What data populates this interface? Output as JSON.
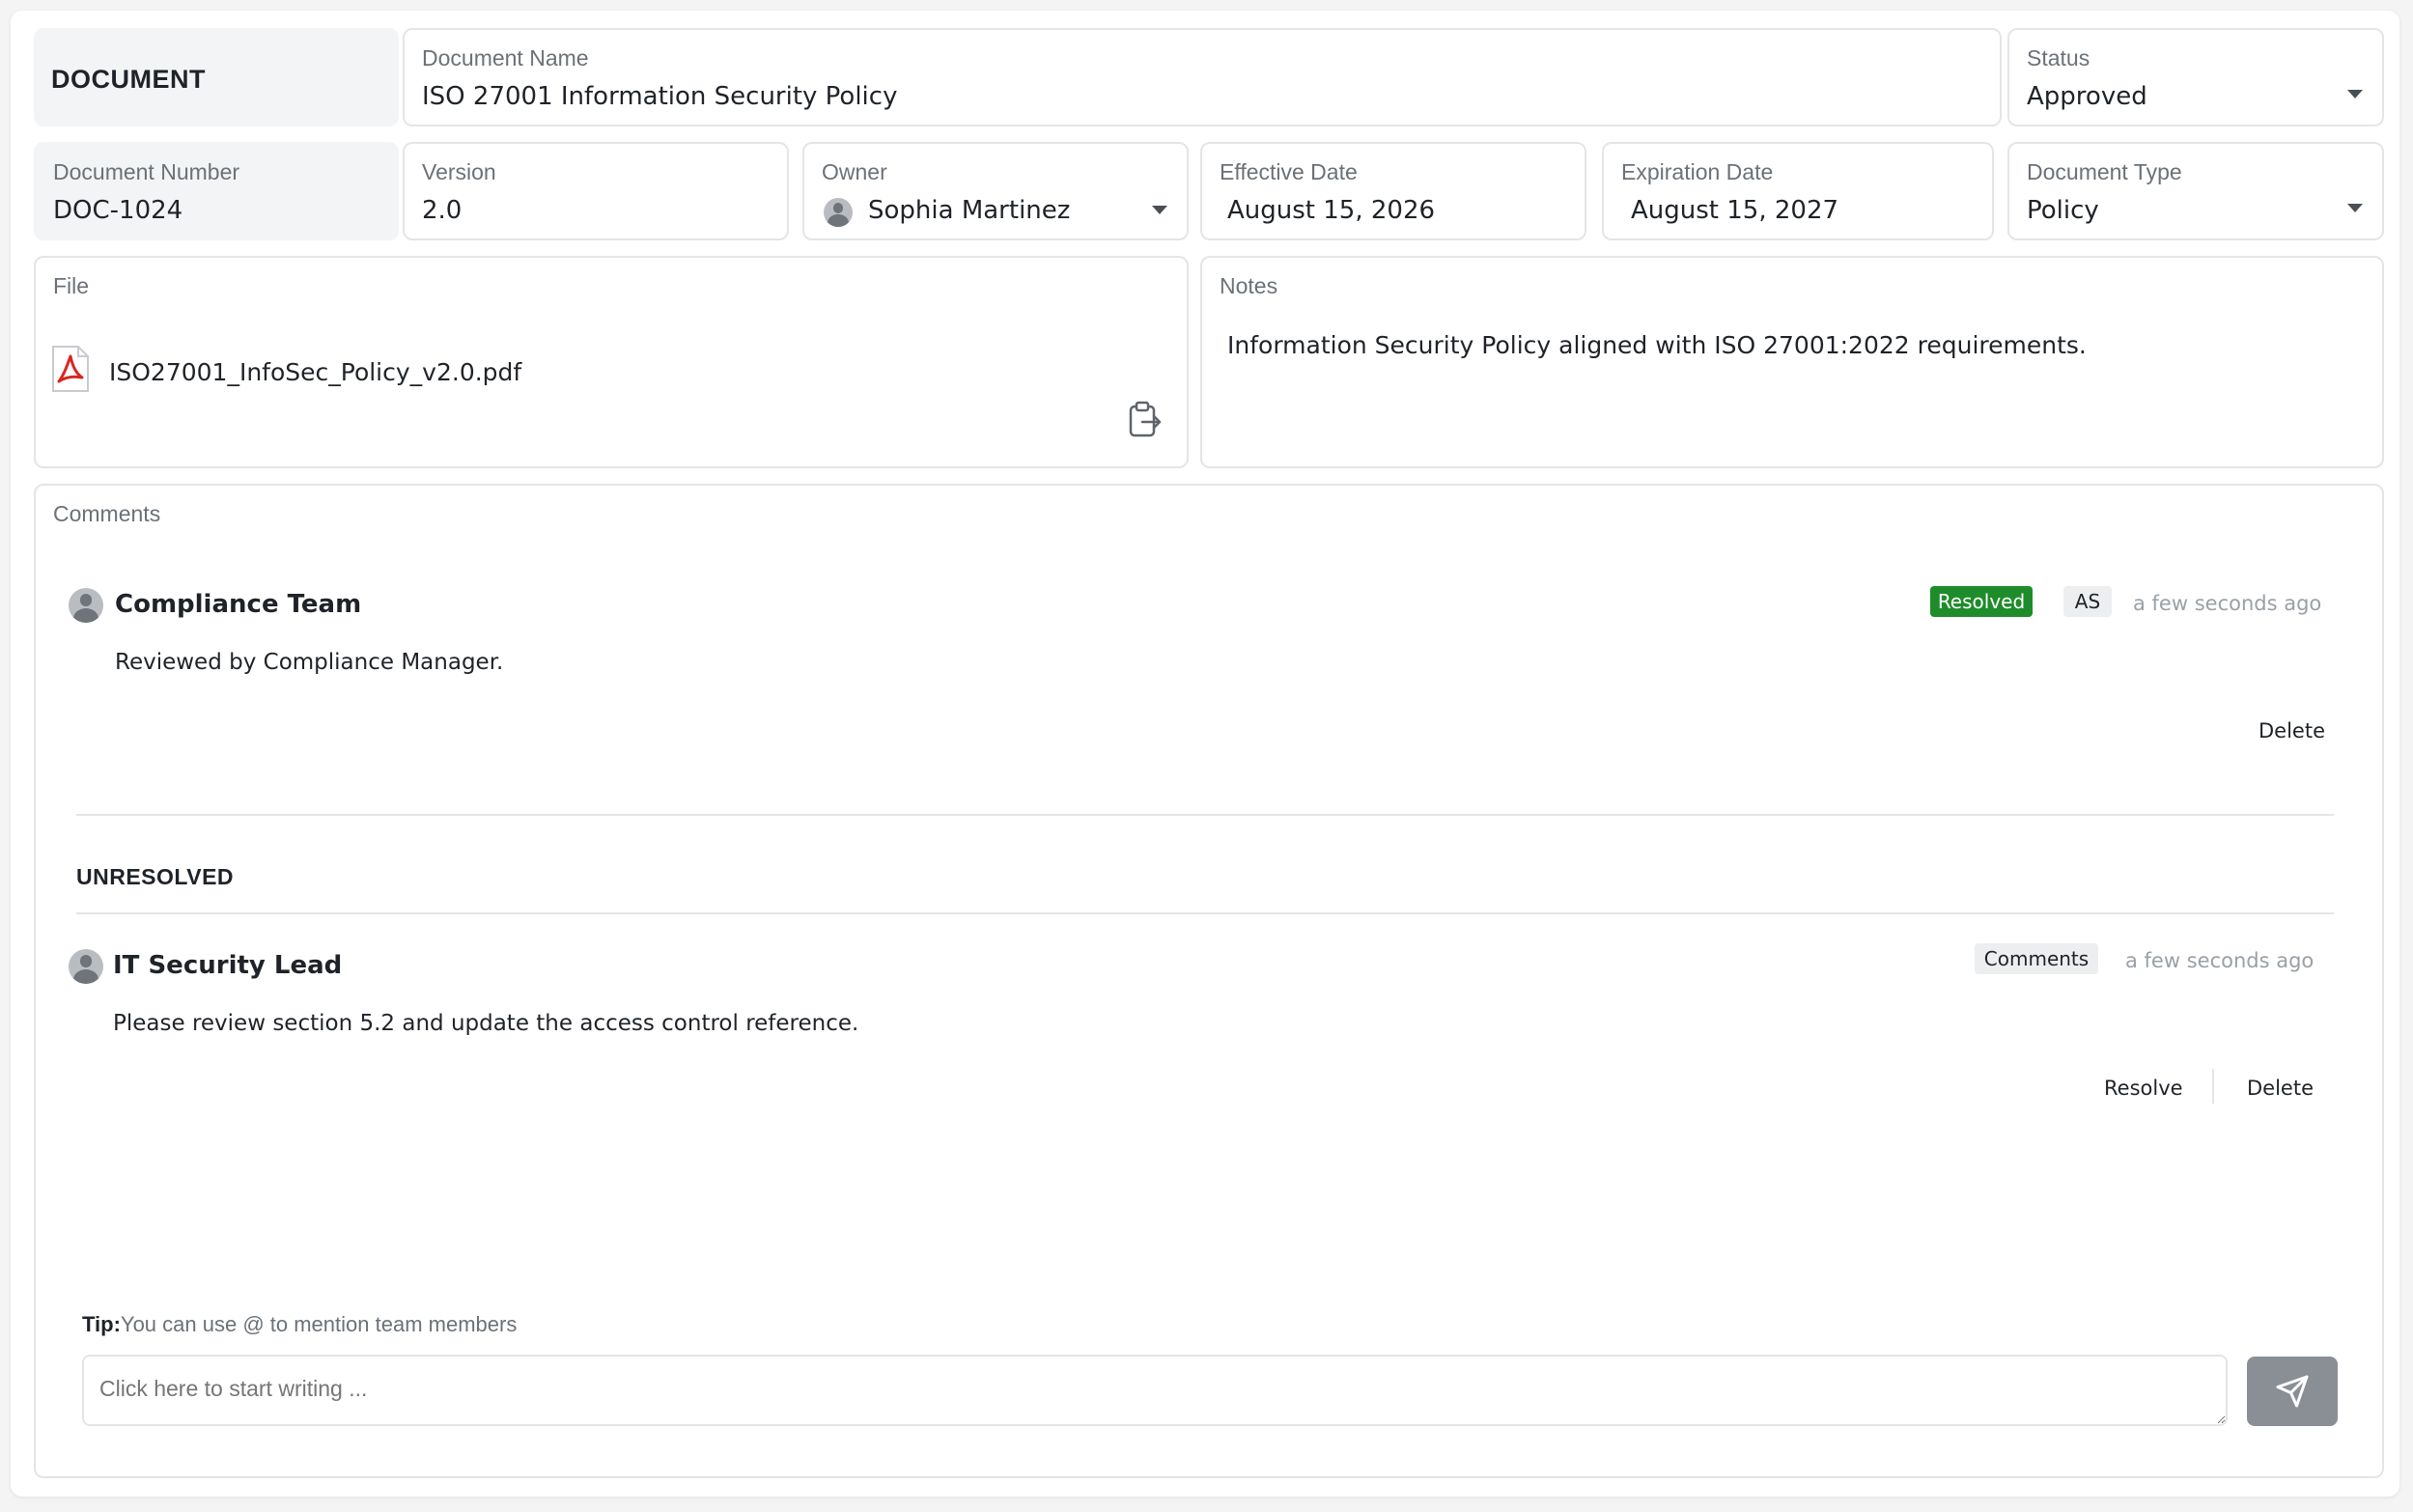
{
  "header": {
    "section_title": "DOCUMENT",
    "document_name": {
      "label": "Document Name",
      "value": "ISO 27001 Information Security Policy"
    },
    "status": {
      "label": "Status",
      "value": "Approved"
    }
  },
  "fields": {
    "document_number": {
      "label": "Document Number",
      "value": "DOC-1024"
    },
    "version": {
      "label": "Version",
      "value": "2.0"
    },
    "owner": {
      "label": "Owner",
      "value": "Sophia Martinez"
    },
    "effective_date": {
      "label": "Effective Date",
      "value": "August 15, 2026"
    },
    "expiration_date": {
      "label": "Expiration Date",
      "value": "August 15, 2027"
    },
    "document_type": {
      "label": "Document Type",
      "value": "Policy"
    }
  },
  "file": {
    "label": "File",
    "filename": "ISO27001_InfoSec_Policy_v2.0.pdf",
    "icon": "pdf-icon",
    "action_icon": "clipboard-export-icon"
  },
  "notes": {
    "label": "Notes",
    "text": "Information Security Policy aligned with ISO 27001:2022 requirements."
  },
  "comments": {
    "label": "Comments",
    "resolved": [
      {
        "author": "Compliance Team",
        "body": "Reviewed by Compliance Manager.",
        "status_badge": "Resolved",
        "initials": "AS",
        "time": "a few seconds ago",
        "delete_label": "Delete"
      }
    ],
    "unresolved_heading": "UNRESOLVED",
    "unresolved": [
      {
        "author": "IT Security Lead",
        "body": "Please review section 5.2 and update the access control reference.",
        "tag": "Comments",
        "time": "a few seconds ago",
        "resolve_label": "Resolve",
        "delete_label": "Delete"
      }
    ],
    "tip_prefix": "Tip:",
    "tip_text": "You can use @ to mention team members",
    "input_placeholder": "Click here to start writing ...",
    "send_icon": "send-icon"
  },
  "colors": {
    "resolved_badge": "#1e8c2a",
    "send_button": "#8a8f96",
    "pdf_red": "#d6281f"
  }
}
